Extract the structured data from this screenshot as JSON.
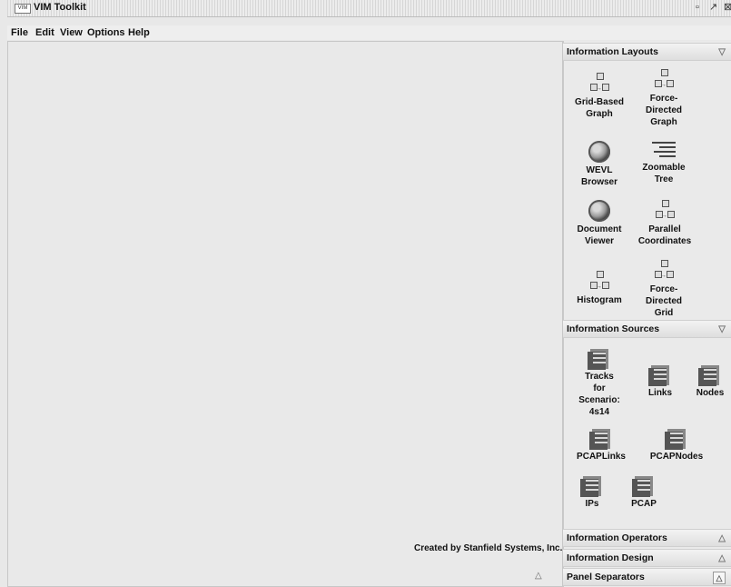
{
  "window": {
    "app_icon_text": "VIM",
    "title": "VIM Toolkit",
    "controls": {
      "minimize": "▫",
      "maximize": "↗",
      "close": "⊠"
    }
  },
  "menu": [
    "File",
    "Edit",
    "View",
    "Options",
    "Help"
  ],
  "canvas": {
    "credit": "Created by Stanfield Systems, Inc.",
    "toggle": "△"
  },
  "panels": {
    "information_layouts": {
      "title": "Information Layouts",
      "arrow": "▽",
      "items": [
        {
          "label": "Grid-Based\nGraph",
          "icon": "graph-icon"
        },
        {
          "label": "Force-\nDirected\nGraph",
          "icon": "graph-icon"
        },
        {
          "label": "WEVL\nBrowser",
          "icon": "sphere-icon"
        },
        {
          "label": "Zoomable\nTree",
          "icon": "tree-icon"
        },
        {
          "label": "Document\nViewer",
          "icon": "sphere-icon"
        },
        {
          "label": "Parallel\nCoordinates",
          "icon": "graph-icon"
        },
        {
          "label": "Histogram",
          "icon": "graph-icon"
        },
        {
          "label": "Force-\nDirected\nGrid",
          "icon": "graph-icon"
        }
      ]
    },
    "information_sources": {
      "title": "Information Sources",
      "arrow": "▽",
      "items": [
        {
          "label": "Tracks\nfor\nScenario:\n4s14",
          "icon": "database-icon"
        },
        {
          "label": "Links",
          "icon": "database-icon"
        },
        {
          "label": "Nodes",
          "icon": "database-icon"
        },
        {
          "label": "PCAPLinks",
          "icon": "database-icon"
        },
        {
          "label": "PCAPNodes",
          "icon": "database-icon"
        },
        {
          "label": "IPs",
          "icon": "database-icon"
        },
        {
          "label": "PCAP",
          "icon": "database-icon"
        }
      ]
    },
    "information_operators": {
      "title": "Information Operators",
      "arrow": "△"
    },
    "information_design": {
      "title": "Information Design",
      "arrow": "△"
    },
    "panel_separators": {
      "title": "Panel Separators",
      "arrow": "△"
    }
  }
}
